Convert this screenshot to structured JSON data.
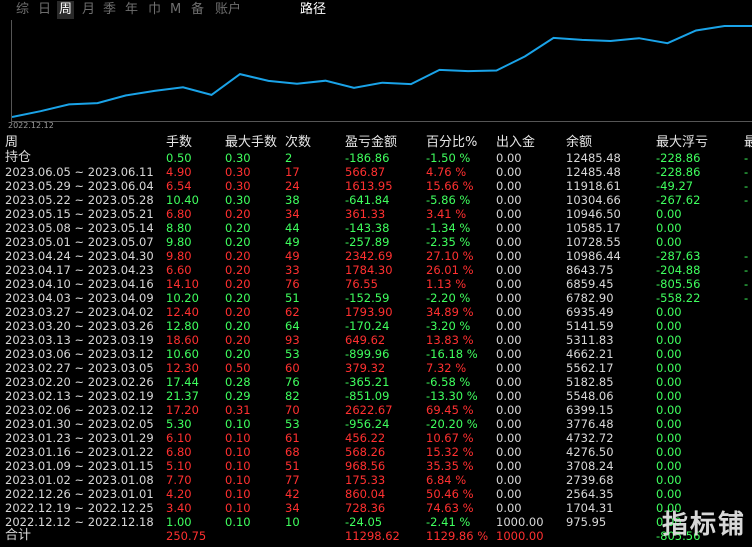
{
  "tabs": [
    {
      "label": "综",
      "active": false
    },
    {
      "label": "日",
      "active": false
    },
    {
      "label": "周",
      "active": true
    },
    {
      "label": "月",
      "active": false
    },
    {
      "label": "季",
      "active": false
    },
    {
      "label": "年",
      "active": false
    },
    {
      "label": "巾",
      "active": false
    },
    {
      "label": "M",
      "active": false
    },
    {
      "label": "备",
      "active": false
    },
    {
      "label": "账户",
      "active": false
    }
  ],
  "path_tab": "路径",
  "chart": {
    "start_date": "2022.12.12",
    "line_color": "#1aa3e8",
    "balances": [
      975.95,
      1704.31,
      2564.35,
      2739.68,
      3708.24,
      4276.5,
      4732.72,
      3776.48,
      6399.15,
      5548.06,
      5182.85,
      5562.17,
      4662.21,
      5311.83,
      5141.59,
      6935.49,
      6782.9,
      6859.45,
      8643.75,
      10986.44,
      10728.55,
      10585.17,
      10946.5,
      10304.66,
      11918.61,
      12485.48,
      12485.48
    ]
  },
  "headers": {
    "week": "周",
    "qty": "手数",
    "maxqty": "最大手数",
    "count": "次数",
    "pnl": "盈亏金额",
    "pct": "百分比%",
    "io": "出入金",
    "bal": "余额",
    "maxf": "最大浮亏",
    "extra": "最"
  },
  "rows": [
    {
      "week": "持仓",
      "qty": "0.50",
      "maxqty": "0.30",
      "count": "2",
      "pnl": "-186.86",
      "pct": "-1.50 %",
      "io": "0.00",
      "bal": "12485.48",
      "maxf": "-228.86",
      "extra": "-",
      "color": "g"
    },
    {
      "week": "2023.06.05 ~ 2023.06.11",
      "qty": "4.90",
      "maxqty": "0.30",
      "count": "17",
      "pnl": "566.87",
      "pct": "4.76 %",
      "io": "0.00",
      "bal": "12485.48",
      "maxf": "-228.86",
      "extra": "-",
      "color": "r"
    },
    {
      "week": "2023.05.29 ~ 2023.06.04",
      "qty": "6.54",
      "maxqty": "0.30",
      "count": "24",
      "pnl": "1613.95",
      "pct": "15.66 %",
      "io": "0.00",
      "bal": "11918.61",
      "maxf": "-49.27",
      "extra": "-",
      "color": "r"
    },
    {
      "week": "2023.05.22 ~ 2023.05.28",
      "qty": "10.40",
      "maxqty": "0.30",
      "count": "38",
      "pnl": "-641.84",
      "pct": "-5.86 %",
      "io": "0.00",
      "bal": "10304.66",
      "maxf": "-267.62",
      "extra": "-",
      "color": "g"
    },
    {
      "week": "2023.05.15 ~ 2023.05.21",
      "qty": "6.80",
      "maxqty": "0.20",
      "count": "34",
      "pnl": "361.33",
      "pct": "3.41 %",
      "io": "0.00",
      "bal": "10946.50",
      "maxf": "0.00",
      "extra": "",
      "color": "r"
    },
    {
      "week": "2023.05.08 ~ 2023.05.14",
      "qty": "8.80",
      "maxqty": "0.20",
      "count": "44",
      "pnl": "-143.38",
      "pct": "-1.34 %",
      "io": "0.00",
      "bal": "10585.17",
      "maxf": "0.00",
      "extra": "",
      "color": "g"
    },
    {
      "week": "2023.05.01 ~ 2023.05.07",
      "qty": "9.80",
      "maxqty": "0.20",
      "count": "49",
      "pnl": "-257.89",
      "pct": "-2.35 %",
      "io": "0.00",
      "bal": "10728.55",
      "maxf": "0.00",
      "extra": "",
      "color": "g"
    },
    {
      "week": "2023.04.24 ~ 2023.04.30",
      "qty": "9.80",
      "maxqty": "0.20",
      "count": "49",
      "pnl": "2342.69",
      "pct": "27.10 %",
      "io": "0.00",
      "bal": "10986.44",
      "maxf": "-287.63",
      "extra": "-",
      "color": "r"
    },
    {
      "week": "2023.04.17 ~ 2023.04.23",
      "qty": "6.60",
      "maxqty": "0.20",
      "count": "33",
      "pnl": "1784.30",
      "pct": "26.01 %",
      "io": "0.00",
      "bal": "8643.75",
      "maxf": "-204.88",
      "extra": "-",
      "color": "r"
    },
    {
      "week": "2023.04.10 ~ 2023.04.16",
      "qty": "14.10",
      "maxqty": "0.20",
      "count": "76",
      "pnl": "76.55",
      "pct": "1.13 %",
      "io": "0.00",
      "bal": "6859.45",
      "maxf": "-805.56",
      "extra": "-",
      "color": "r"
    },
    {
      "week": "2023.04.03 ~ 2023.04.09",
      "qty": "10.20",
      "maxqty": "0.20",
      "count": "51",
      "pnl": "-152.59",
      "pct": "-2.20 %",
      "io": "0.00",
      "bal": "6782.90",
      "maxf": "-558.22",
      "extra": "-",
      "color": "g"
    },
    {
      "week": "2023.03.27 ~ 2023.04.02",
      "qty": "12.40",
      "maxqty": "0.20",
      "count": "62",
      "pnl": "1793.90",
      "pct": "34.89 %",
      "io": "0.00",
      "bal": "6935.49",
      "maxf": "0.00",
      "extra": "",
      "color": "r"
    },
    {
      "week": "2023.03.20 ~ 2023.03.26",
      "qty": "12.80",
      "maxqty": "0.20",
      "count": "64",
      "pnl": "-170.24",
      "pct": "-3.20 %",
      "io": "0.00",
      "bal": "5141.59",
      "maxf": "0.00",
      "extra": "",
      "color": "g"
    },
    {
      "week": "2023.03.13 ~ 2023.03.19",
      "qty": "18.60",
      "maxqty": "0.20",
      "count": "93",
      "pnl": "649.62",
      "pct": "13.83 %",
      "io": "0.00",
      "bal": "5311.83",
      "maxf": "0.00",
      "extra": "",
      "color": "r"
    },
    {
      "week": "2023.03.06 ~ 2023.03.12",
      "qty": "10.60",
      "maxqty": "0.20",
      "count": "53",
      "pnl": "-899.96",
      "pct": "-16.18 %",
      "io": "0.00",
      "bal": "4662.21",
      "maxf": "0.00",
      "extra": "",
      "color": "g"
    },
    {
      "week": "2023.02.27 ~ 2023.03.05",
      "qty": "12.30",
      "maxqty": "0.50",
      "count": "60",
      "pnl": "379.32",
      "pct": "7.32 %",
      "io": "0.00",
      "bal": "5562.17",
      "maxf": "0.00",
      "extra": "",
      "color": "r"
    },
    {
      "week": "2023.02.20 ~ 2023.02.26",
      "qty": "17.44",
      "maxqty": "0.28",
      "count": "76",
      "pnl": "-365.21",
      "pct": "-6.58 %",
      "io": "0.00",
      "bal": "5182.85",
      "maxf": "0.00",
      "extra": "",
      "color": "g"
    },
    {
      "week": "2023.02.13 ~ 2023.02.19",
      "qty": "21.37",
      "maxqty": "0.29",
      "count": "82",
      "pnl": "-851.09",
      "pct": "-13.30 %",
      "io": "0.00",
      "bal": "5548.06",
      "maxf": "0.00",
      "extra": "",
      "color": "g"
    },
    {
      "week": "2023.02.06 ~ 2023.02.12",
      "qty": "17.20",
      "maxqty": "0.31",
      "count": "70",
      "pnl": "2622.67",
      "pct": "69.45 %",
      "io": "0.00",
      "bal": "6399.15",
      "maxf": "0.00",
      "extra": "",
      "color": "r"
    },
    {
      "week": "2023.01.30 ~ 2023.02.05",
      "qty": "5.30",
      "maxqty": "0.10",
      "count": "53",
      "pnl": "-956.24",
      "pct": "-20.20 %",
      "io": "0.00",
      "bal": "3776.48",
      "maxf": "0.00",
      "extra": "",
      "color": "g"
    },
    {
      "week": "2023.01.23 ~ 2023.01.29",
      "qty": "6.10",
      "maxqty": "0.10",
      "count": "61",
      "pnl": "456.22",
      "pct": "10.67 %",
      "io": "0.00",
      "bal": "4732.72",
      "maxf": "0.00",
      "extra": "",
      "color": "r"
    },
    {
      "week": "2023.01.16 ~ 2023.01.22",
      "qty": "6.80",
      "maxqty": "0.10",
      "count": "68",
      "pnl": "568.26",
      "pct": "15.32 %",
      "io": "0.00",
      "bal": "4276.50",
      "maxf": "0.00",
      "extra": "",
      "color": "r"
    },
    {
      "week": "2023.01.09 ~ 2023.01.15",
      "qty": "5.10",
      "maxqty": "0.10",
      "count": "51",
      "pnl": "968.56",
      "pct": "35.35 %",
      "io": "0.00",
      "bal": "3708.24",
      "maxf": "0.00",
      "extra": "",
      "color": "r"
    },
    {
      "week": "2023.01.02 ~ 2023.01.08",
      "qty": "7.70",
      "maxqty": "0.10",
      "count": "77",
      "pnl": "175.33",
      "pct": "6.84 %",
      "io": "0.00",
      "bal": "2739.68",
      "maxf": "0.00",
      "extra": "",
      "color": "r"
    },
    {
      "week": "2022.12.26 ~ 2023.01.01",
      "qty": "4.20",
      "maxqty": "0.10",
      "count": "42",
      "pnl": "860.04",
      "pct": "50.46 %",
      "io": "0.00",
      "bal": "2564.35",
      "maxf": "0.00",
      "extra": "",
      "color": "r"
    },
    {
      "week": "2022.12.19 ~ 2022.12.25",
      "qty": "3.40",
      "maxqty": "0.10",
      "count": "34",
      "pnl": "728.36",
      "pct": "74.63 %",
      "io": "0.00",
      "bal": "1704.31",
      "maxf": "0.00",
      "extra": "",
      "color": "r"
    },
    {
      "week": "2022.12.12 ~ 2022.12.18",
      "qty": "1.00",
      "maxqty": "0.10",
      "count": "10",
      "pnl": "-24.05",
      "pct": "-2.41 %",
      "io": "1000.00",
      "bal": "975.95",
      "maxf": "0.00",
      "extra": "",
      "color": "g"
    }
  ],
  "total": {
    "week": "合计",
    "qty": "250.75",
    "pnl": "11298.62",
    "pct": "1129.86 %",
    "io": "1000.00",
    "maxf": "-805.56"
  },
  "watermark": "指标铺"
}
